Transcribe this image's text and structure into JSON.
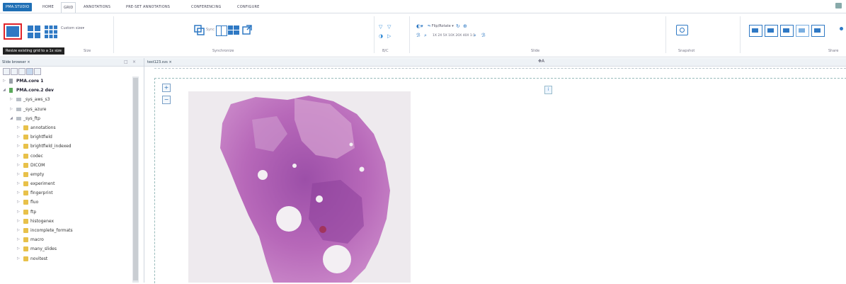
{
  "tabs": [
    "PMA.STUDIO",
    "HOME",
    "GRID",
    "ANNOTATIONS",
    "PRE-SET ANNOTATIONS",
    "CONFERENCING",
    "CONFIGURE"
  ],
  "ribbon": {
    "custom_size_label": "Custom size",
    "groups": {
      "size": "Size",
      "synchronize": "Synchronize",
      "bc": "B/C",
      "slide": "Slide",
      "snapshot": "Snapshot",
      "share": "Share"
    },
    "flip_rotate_label": "Flip/Rotate",
    "zoom_levels": [
      "1X",
      "2X",
      "5X",
      "10X",
      "20X",
      "40X",
      "1:1"
    ],
    "sync_label": "Sync"
  },
  "tooltip": "Resize existing grid to a 1x size",
  "left_panel": {
    "tab": "Slide browser",
    "tree": [
      {
        "label": "PMA.core 1",
        "level": 0,
        "type": "server",
        "expanded": false,
        "bold": true
      },
      {
        "label": "PMA.core.2 dev",
        "level": 0,
        "type": "server",
        "expanded": true,
        "bold": true
      },
      {
        "label": "_sys_aws_s3",
        "level": 1,
        "type": "drive",
        "expanded": false
      },
      {
        "label": "_sys_azure",
        "level": 1,
        "type": "drive",
        "expanded": false
      },
      {
        "label": "_sys_ftp",
        "level": 1,
        "type": "drive",
        "expanded": true
      },
      {
        "label": "annotations",
        "level": 2,
        "type": "folder"
      },
      {
        "label": "brightfield",
        "level": 2,
        "type": "folder"
      },
      {
        "label": "brightfield_indexed",
        "level": 2,
        "type": "folder"
      },
      {
        "label": "codec",
        "level": 2,
        "type": "folder"
      },
      {
        "label": "DICOM",
        "level": 2,
        "type": "folder"
      },
      {
        "label": "empty",
        "level": 2,
        "type": "folder"
      },
      {
        "label": "experiment",
        "level": 2,
        "type": "folder"
      },
      {
        "label": "fingerprint",
        "level": 2,
        "type": "folder"
      },
      {
        "label": "fluo",
        "level": 2,
        "type": "folder"
      },
      {
        "label": "ftp",
        "level": 2,
        "type": "folder"
      },
      {
        "label": "histogenex",
        "level": 2,
        "type": "folder"
      },
      {
        "label": "incomplete_formats",
        "level": 2,
        "type": "folder"
      },
      {
        "label": "macro",
        "level": 2,
        "type": "folder"
      },
      {
        "label": "many_slides",
        "level": 2,
        "type": "folder"
      },
      {
        "label": "novitest",
        "level": 2,
        "type": "folder"
      }
    ]
  },
  "viewer": {
    "tab": "test123.svs",
    "compass": "A",
    "zoom_in": "+",
    "zoom_out": "−",
    "info": "i"
  },
  "colors": {
    "accent": "#1f6fb5",
    "highlight": "#e0242b",
    "folder": "#e8c14a",
    "tissue": "#b05fb0"
  }
}
